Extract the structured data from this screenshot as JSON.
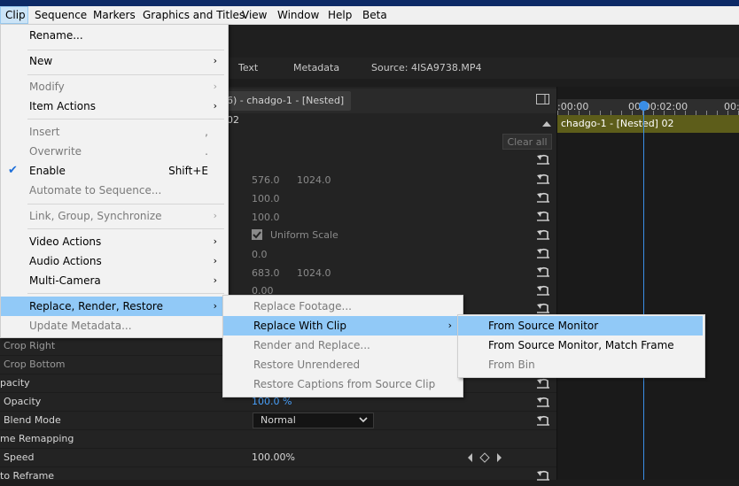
{
  "menubar": {
    "items": [
      "Clip",
      "Sequence",
      "Markers",
      "Graphics and Titles",
      "View",
      "Window",
      "Help",
      "Beta"
    ],
    "active": "Clip"
  },
  "source_tabs": {
    "text": "Text",
    "metadata": "Metadata",
    "source": "Source: 4ISA9738.MP4"
  },
  "effect_controls": {
    "clip_tab": "6) - chadgo-1 - [Nested] 02",
    "clear_all": "Clear all",
    "values": {
      "position_x": "576.0",
      "position_y": "1024.0",
      "scale": "100.0",
      "scale_width": "100.0",
      "uniform_scale": "Uniform Scale",
      "rotation": "0.0",
      "anchor_x": "683.0",
      "anchor_y": "1024.0",
      "flicker": "0.00"
    },
    "rows": {
      "crop_right": "Crop Right",
      "crop_bottom": "Crop Bottom",
      "opacity_section": "pacity",
      "opacity": "Opacity",
      "opacity_value": "100.0 %",
      "blend_mode": "Blend Mode",
      "blend_value": "Normal",
      "time_remapping": "me Remapping",
      "speed": "Speed",
      "speed_value": "100.00%",
      "auto_reframe": "to Reframe"
    }
  },
  "timeline": {
    "timecode_start": ":00:00",
    "timecode_mid": "00:00:02:00",
    "timecode_end": "00:",
    "clip_name": "chadgo-1 - [Nested] 02"
  },
  "clip_menu": {
    "rename": "Rename...",
    "new": "New",
    "modify": "Modify",
    "item_actions": "Item Actions",
    "insert": "Insert",
    "insert_shortcut": ",",
    "overwrite": "Overwrite",
    "overwrite_shortcut": ".",
    "enable": "Enable",
    "enable_shortcut": "Shift+E",
    "automate": "Automate to Sequence...",
    "link_group": "Link, Group, Synchronize",
    "video_actions": "Video Actions",
    "audio_actions": "Audio Actions",
    "multi_camera": "Multi-Camera",
    "replace_render": "Replace, Render, Restore",
    "update_metadata": "Update Metadata..."
  },
  "replace_menu": {
    "replace_footage": "Replace Footage...",
    "replace_with_clip": "Replace With Clip",
    "render_and_replace": "Render and Replace...",
    "restore_unrendered": "Restore Unrendered",
    "restore_captions": "Restore Captions from Source Clip"
  },
  "replace_clip_menu": {
    "from_source_monitor": "From Source Monitor",
    "from_source_monitor_match": "From Source Monitor, Match Frame",
    "from_bin": "From Bin"
  },
  "colors": {
    "accent": "#3a8ee6",
    "menu_highlight": "#91c9f7",
    "clip_bar": "#5d5d1a"
  }
}
